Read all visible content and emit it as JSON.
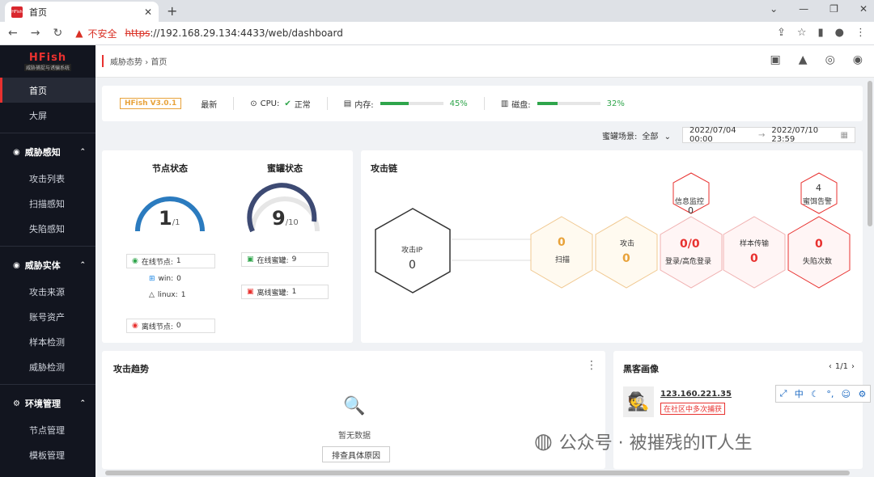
{
  "browser": {
    "tab_title": "首页",
    "tab_favicon": "HFish",
    "warning_text": "不安全",
    "url_scheme": "https",
    "url_rest": "://192.168.29.134:4433/web/dashboard"
  },
  "sidebar": {
    "logo_title": "HFish",
    "logo_subtitle": "威胁捕捉与诱骗系统",
    "items_top": [
      {
        "label": "首页",
        "active": true
      },
      {
        "label": "大屏"
      }
    ],
    "groups": [
      {
        "label": "威胁感知",
        "icon": "eye-icon",
        "items": [
          "攻击列表",
          "扫描感知",
          "失陷感知"
        ]
      },
      {
        "label": "威胁实体",
        "icon": "target-icon",
        "items": [
          "攻击来源",
          "账号资产",
          "样本检测",
          "威胁检测"
        ]
      },
      {
        "label": "环境管理",
        "icon": "gear-icon",
        "items": [
          "节点管理",
          "模板管理"
        ]
      }
    ]
  },
  "topbar": {
    "breadcrumb_parent": "威胁态势",
    "breadcrumb_sep": "›",
    "breadcrumb_current": "首页"
  },
  "infobar": {
    "version": "HFish V3.0.1",
    "latest": "最新",
    "cpu_label": "CPU:",
    "cpu_status": "正常",
    "mem_label": "内存:",
    "mem_pct": "45%",
    "mem_value": 0.45,
    "disk_label": "磁盘:",
    "disk_pct": "32%",
    "disk_value": 0.32
  },
  "filter": {
    "scene_label": "蜜罐场景:",
    "scene_value": "全部",
    "date_start": "2022/07/04 00:00",
    "date_arrow": "→",
    "date_end": "2022/07/10 23:59"
  },
  "node_status": {
    "title": "节点状态",
    "value": "1",
    "total": "/1",
    "online": "在线节点:",
    "online_count": "1",
    "win": "win:",
    "win_count": "0",
    "linux": "linux:",
    "linux_count": "1",
    "offline": "离线节点:",
    "offline_count": "0"
  },
  "honeypot_status": {
    "title": "蜜罐状态",
    "value": "9",
    "total": "/10",
    "online": "在线蜜罐:",
    "online_count": "9",
    "offline": "离线蜜罐:",
    "offline_count": "1"
  },
  "attack_chain": {
    "title": "攻击链",
    "source_label": "攻击IP",
    "source_value": "0",
    "scan_label": "扫描",
    "scan_value": "0",
    "attack_label": "攻击",
    "attack_value": "0",
    "login_label": "登录/高危登录",
    "login_value": "0/0",
    "sample_label": "样本传输",
    "sample_value": "0",
    "fall_label": "失陷次数",
    "fall_value": "0",
    "credential_label": "信息监控",
    "credential_value": "0",
    "honey_label": "蜜饵告警",
    "honey_value": "4"
  },
  "trend": {
    "title": "攻击趋势",
    "empty": "暂无数据",
    "reason_button": "排查具体原因"
  },
  "hacker": {
    "title": "黑客画像",
    "pager": "1/1",
    "ip": "123.160.221.35",
    "tag": "在社区中多次捕获"
  },
  "watermark": "公众号 · 被摧残的IT人生",
  "ime": {
    "lang": "中"
  },
  "colors": {
    "accent": "#e8312f",
    "ok": "#2fa54b",
    "gauge_node": "#2b7bbf",
    "gauge_honey": "#3d4a73"
  }
}
